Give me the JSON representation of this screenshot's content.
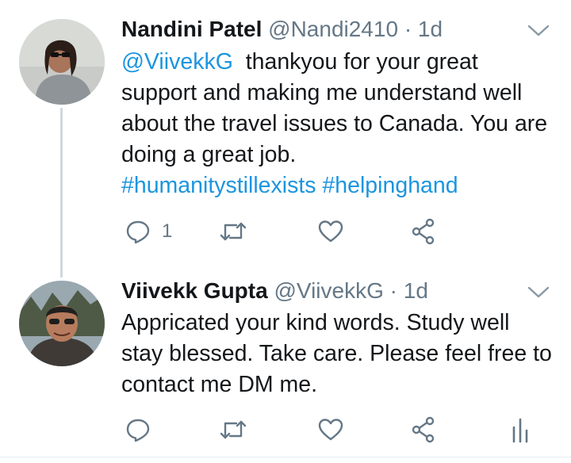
{
  "tweets": [
    {
      "name": "Nandini Patel",
      "handle": "@Nandi2410",
      "time": "· 1d",
      "mention": "@ViivekkG",
      "text": "thankyou for your great support and making me understand well about the travel issues to Canada. You are doing a great job.",
      "hashtags": "#humanitystillexists #helpinghand",
      "reply_count": "1"
    },
    {
      "name": "Viivekk Gupta",
      "handle": "@ViivekkG",
      "time": "· 1d",
      "text": "Appricated your kind words. Study well stay blessed. Take care. Please feel free to contact me DM me."
    }
  ],
  "colors": {
    "accent": "#1b95e0",
    "icon": "#657786",
    "thread_line": "#cfd9de"
  }
}
